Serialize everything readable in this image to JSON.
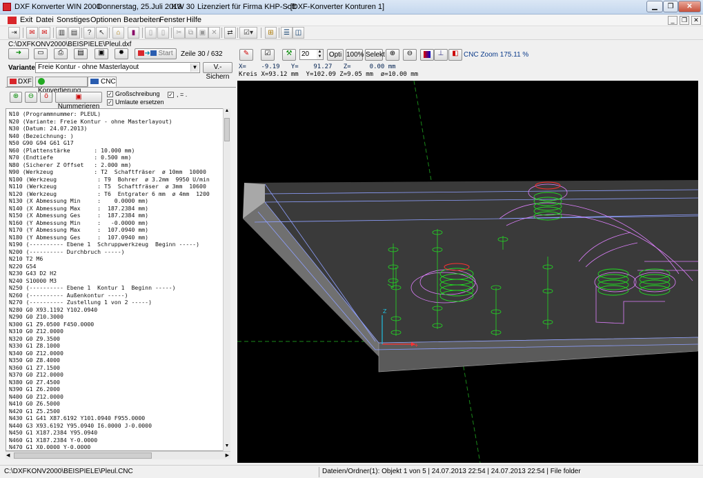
{
  "titlebar": {
    "app": "DXF Konverter WIN 2000",
    "date": "Donnerstag, 25.Juli 2013",
    "week": "KW 30",
    "license": "Lizenziert für Firma KHP-Soft",
    "document": "- [DXF-Konverter Konturen 1]"
  },
  "menu": [
    "Exit",
    "Datei",
    "Sonstiges",
    "Optionen",
    "Bearbeiten",
    "Fenster",
    "Hilfe"
  ],
  "path": "C:\\DXFKONV2000\\BEISPIELE\\Pleul.dxf",
  "left_toolbar": {
    "start_label": "Start",
    "line_info": "Zeile 30 / 632"
  },
  "variant": {
    "label": "Variante",
    "value": "Freie Kontur - ohne Masterlayout",
    "button": "V.-Sichern"
  },
  "tabs": [
    "DXF",
    "Konvertierung",
    "CNC"
  ],
  "cnc_options": {
    "number_button": "Nummerieren",
    "check1": "Großschreibung",
    "check2": "Umlaute ersetzen",
    "check3": ", = ."
  },
  "code_lines": [
    "N10 (Programmnummer: PLEUL)",
    "N20 (Variante: Freie Kontur - ohne Masterlayout)",
    "N30 (Datum: 24.07.2013)",
    "N40 (Bezeichnung: )",
    "N50 G90 G94 G61 G17",
    "N60 (Plattenstärke       : 10.000 mm)",
    "N70 (Endtiefe            : 0.500 mm)",
    "N80 (Sicherer Z Offset   : 2.000 mm)",
    "N90 (Werkzeug            : T2  Schaftfräser  ø 10mm  10000",
    "N100 (Werkzeug            : T9  Bohrer  ø 3.2mm  9950 U/min",
    "N110 (Werkzeug            : T5  Schaftfräser  ø 3mm  10600",
    "N120 (Werkzeug            : T6  Entgrater 6 mm  ø 4mm  1200",
    "N130 (X Abmessung Min     :    0.0000 mm)",
    "N140 (X Abmessung Max     :  187.2384 mm)",
    "N150 (X Abmessung Ges     :  187.2384 mm)",
    "N160 (Y Abmessung Min     :   -0.0000 mm)",
    "N170 (Y Abmessung Max     :  107.0940 mm)",
    "N180 (Y Abmessung Ges     :  107.0940 mm)",
    "N190 (---------- Ebene 1  Schruppwerkzeug  Beginn -----)",
    "N200 (---------- Durchbruch -----)",
    "N210 T2 M6",
    "N220 G54",
    "N230 G43 D2 H2",
    "N240 S10000 M3",
    "N250 (---------- Ebene 1  Kontur 1  Beginn -----)",
    "N260 (---------- Außenkontur -----)",
    "N270 (---------- Zustellung 1 von 2 -----)",
    "N280 G0 X93.1192 Y102.0940",
    "N290 G0 Z10.3000",
    "N300 G1 Z9.0500 F450.0000",
    "N310 G0 Z12.0000",
    "N320 G0 Z9.3500",
    "N330 G1 Z8.1000",
    "N340 G0 Z12.0000",
    "N350 G0 Z8.4000",
    "N360 G1 Z7.1500",
    "N370 G0 Z12.0000",
    "N380 G0 Z7.4500",
    "N390 G1 Z6.2000",
    "N400 G0 Z12.0000",
    "N410 G0 Z6.5000",
    "N420 G1 Z5.2500",
    "N430 G1 G41 X87.6192 Y101.0940 F955.0000",
    "N440 G3 X93.6192 Y95.0940 I6.0000 J-0.0000",
    "N450 G1 X187.2384 Y95.0940",
    "N460 G1 X187.2384 Y-0.0000",
    "N470 G1 X0.0000 Y-0.0000"
  ],
  "view_toolbar": {
    "step_value": "20",
    "opti_label": "Opti",
    "zoom100_label": "100%",
    "select_label": "Selekt",
    "zoom_text": "CNC Zoom 175.11 %"
  },
  "readout": {
    "line1": "X=    -9.19   Y=    91.27   Z=     0.00 mm",
    "line2": "Kreis X=93.12 mm  Y=102.09 Z=9.05 mm  ø=10.00 mm"
  },
  "status": {
    "left": "C:\\DXFKONV2000\\BEISPIELE\\Pleul.CNC",
    "right": "Dateien/Ordner(1): Objekt 1 von 5 | 24.07.2013 22:54 | 24.07.2013 22:54 | File folder"
  },
  "colors": {
    "plate_edge": "#b8b8b8",
    "wire_blue": "#8fa0ff",
    "wire_magenta": "#e080ff",
    "toolpath_green": "#22dd22"
  }
}
